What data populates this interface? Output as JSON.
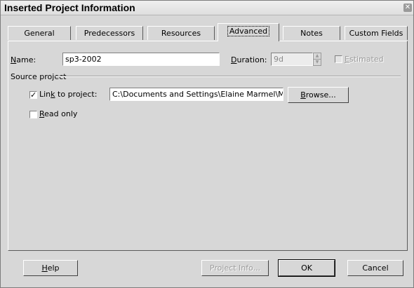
{
  "window": {
    "title": "Inserted Project Information"
  },
  "tabs": [
    {
      "label": "General"
    },
    {
      "label": "Predecessors"
    },
    {
      "label": "Resources"
    },
    {
      "label": "Advanced"
    },
    {
      "label": "Notes"
    },
    {
      "label": "Custom Fields"
    }
  ],
  "active_tab": "Advanced",
  "form": {
    "name_label": "Name:",
    "name_value": "sp3-2002",
    "duration_label": "Duration:",
    "duration_value": "9d",
    "estimated_label": "Estimated",
    "estimated_checked": false,
    "source_group_label": "Source project",
    "link_label": "Link to project:",
    "link_checked": true,
    "link_value": "C:\\Documents and Settings\\Elaine Marmel\\M",
    "browse_label": "Browse...",
    "readonly_label": "Read only",
    "readonly_checked": false
  },
  "buttons": {
    "help": "Help",
    "project_info": "Project Info...",
    "ok": "OK",
    "cancel": "Cancel"
  },
  "icons": {
    "close": "close-icon",
    "check": "check-icon",
    "spin_up": "spin-up-icon",
    "spin_down": "spin-down-icon"
  }
}
